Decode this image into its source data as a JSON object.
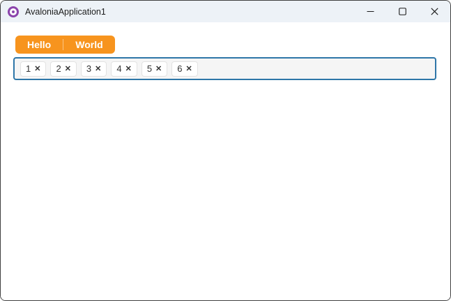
{
  "window": {
    "title": "AvaloniaApplication1"
  },
  "icons": {
    "app_logo": "avalonia-logo",
    "minimize": "minimize-icon",
    "maximize": "maximize-icon",
    "close": "close-icon"
  },
  "tabs": {
    "items": [
      {
        "label": "Hello"
      },
      {
        "label": "World"
      }
    ]
  },
  "chip_input": {
    "chips": [
      {
        "label": "1"
      },
      {
        "label": "2"
      },
      {
        "label": "3"
      },
      {
        "label": "4"
      },
      {
        "label": "5"
      },
      {
        "label": "6"
      }
    ],
    "remove_glyph": "✕"
  },
  "colors": {
    "accent_orange": "#F7941E",
    "focus_border": "#2E76A8",
    "titlebar_bg": "#EDF2F7",
    "window_border": "#3F3F3F",
    "logo_purple": "#8B44AC",
    "chip_bg": "#FFFFFF",
    "chip_area_bg": "#F5F5F5"
  }
}
